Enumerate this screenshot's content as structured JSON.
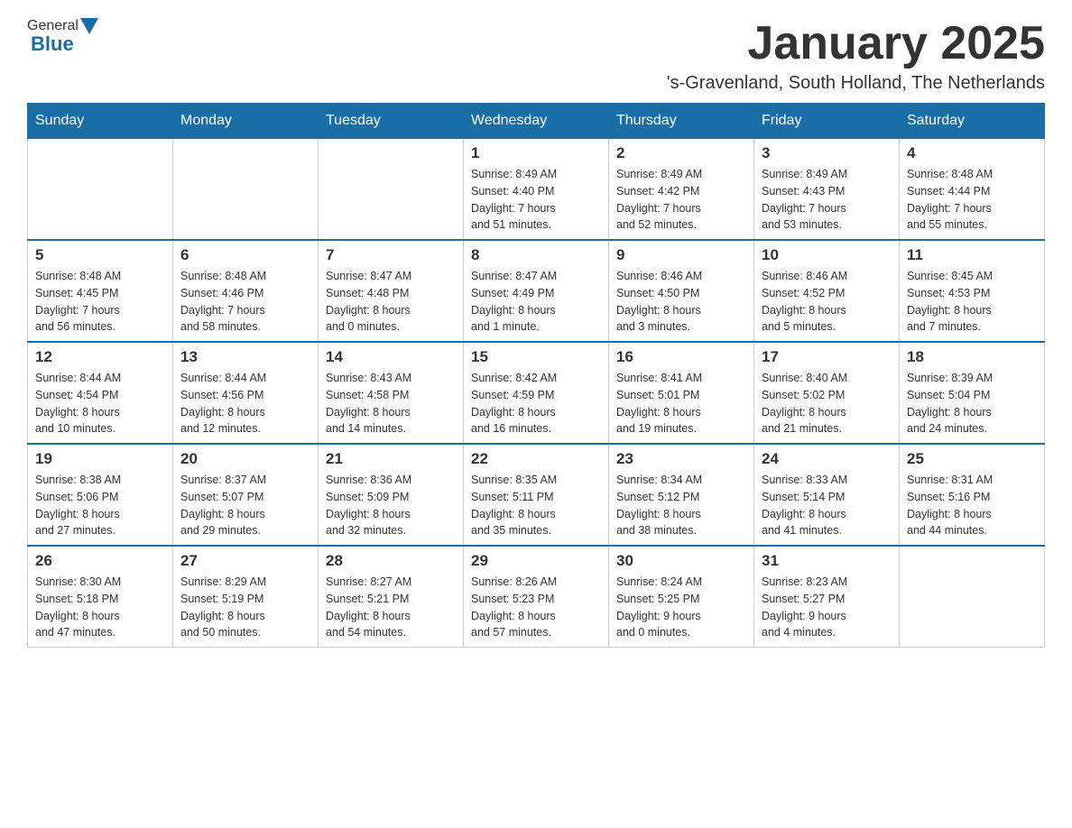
{
  "header": {
    "logo_general": "General",
    "logo_blue": "Blue",
    "month_title": "January 2025",
    "location": "'s-Gravenland, South Holland, The Netherlands"
  },
  "weekdays": [
    "Sunday",
    "Monday",
    "Tuesday",
    "Wednesday",
    "Thursday",
    "Friday",
    "Saturday"
  ],
  "weeks": [
    {
      "days": [
        {
          "num": "",
          "info": ""
        },
        {
          "num": "",
          "info": ""
        },
        {
          "num": "",
          "info": ""
        },
        {
          "num": "1",
          "info": "Sunrise: 8:49 AM\nSunset: 4:40 PM\nDaylight: 7 hours\nand 51 minutes."
        },
        {
          "num": "2",
          "info": "Sunrise: 8:49 AM\nSunset: 4:42 PM\nDaylight: 7 hours\nand 52 minutes."
        },
        {
          "num": "3",
          "info": "Sunrise: 8:49 AM\nSunset: 4:43 PM\nDaylight: 7 hours\nand 53 minutes."
        },
        {
          "num": "4",
          "info": "Sunrise: 8:48 AM\nSunset: 4:44 PM\nDaylight: 7 hours\nand 55 minutes."
        }
      ]
    },
    {
      "days": [
        {
          "num": "5",
          "info": "Sunrise: 8:48 AM\nSunset: 4:45 PM\nDaylight: 7 hours\nand 56 minutes."
        },
        {
          "num": "6",
          "info": "Sunrise: 8:48 AM\nSunset: 4:46 PM\nDaylight: 7 hours\nand 58 minutes."
        },
        {
          "num": "7",
          "info": "Sunrise: 8:47 AM\nSunset: 4:48 PM\nDaylight: 8 hours\nand 0 minutes."
        },
        {
          "num": "8",
          "info": "Sunrise: 8:47 AM\nSunset: 4:49 PM\nDaylight: 8 hours\nand 1 minute."
        },
        {
          "num": "9",
          "info": "Sunrise: 8:46 AM\nSunset: 4:50 PM\nDaylight: 8 hours\nand 3 minutes."
        },
        {
          "num": "10",
          "info": "Sunrise: 8:46 AM\nSunset: 4:52 PM\nDaylight: 8 hours\nand 5 minutes."
        },
        {
          "num": "11",
          "info": "Sunrise: 8:45 AM\nSunset: 4:53 PM\nDaylight: 8 hours\nand 7 minutes."
        }
      ]
    },
    {
      "days": [
        {
          "num": "12",
          "info": "Sunrise: 8:44 AM\nSunset: 4:54 PM\nDaylight: 8 hours\nand 10 minutes."
        },
        {
          "num": "13",
          "info": "Sunrise: 8:44 AM\nSunset: 4:56 PM\nDaylight: 8 hours\nand 12 minutes."
        },
        {
          "num": "14",
          "info": "Sunrise: 8:43 AM\nSunset: 4:58 PM\nDaylight: 8 hours\nand 14 minutes."
        },
        {
          "num": "15",
          "info": "Sunrise: 8:42 AM\nSunset: 4:59 PM\nDaylight: 8 hours\nand 16 minutes."
        },
        {
          "num": "16",
          "info": "Sunrise: 8:41 AM\nSunset: 5:01 PM\nDaylight: 8 hours\nand 19 minutes."
        },
        {
          "num": "17",
          "info": "Sunrise: 8:40 AM\nSunset: 5:02 PM\nDaylight: 8 hours\nand 21 minutes."
        },
        {
          "num": "18",
          "info": "Sunrise: 8:39 AM\nSunset: 5:04 PM\nDaylight: 8 hours\nand 24 minutes."
        }
      ]
    },
    {
      "days": [
        {
          "num": "19",
          "info": "Sunrise: 8:38 AM\nSunset: 5:06 PM\nDaylight: 8 hours\nand 27 minutes."
        },
        {
          "num": "20",
          "info": "Sunrise: 8:37 AM\nSunset: 5:07 PM\nDaylight: 8 hours\nand 29 minutes."
        },
        {
          "num": "21",
          "info": "Sunrise: 8:36 AM\nSunset: 5:09 PM\nDaylight: 8 hours\nand 32 minutes."
        },
        {
          "num": "22",
          "info": "Sunrise: 8:35 AM\nSunset: 5:11 PM\nDaylight: 8 hours\nand 35 minutes."
        },
        {
          "num": "23",
          "info": "Sunrise: 8:34 AM\nSunset: 5:12 PM\nDaylight: 8 hours\nand 38 minutes."
        },
        {
          "num": "24",
          "info": "Sunrise: 8:33 AM\nSunset: 5:14 PM\nDaylight: 8 hours\nand 41 minutes."
        },
        {
          "num": "25",
          "info": "Sunrise: 8:31 AM\nSunset: 5:16 PM\nDaylight: 8 hours\nand 44 minutes."
        }
      ]
    },
    {
      "days": [
        {
          "num": "26",
          "info": "Sunrise: 8:30 AM\nSunset: 5:18 PM\nDaylight: 8 hours\nand 47 minutes."
        },
        {
          "num": "27",
          "info": "Sunrise: 8:29 AM\nSunset: 5:19 PM\nDaylight: 8 hours\nand 50 minutes."
        },
        {
          "num": "28",
          "info": "Sunrise: 8:27 AM\nSunset: 5:21 PM\nDaylight: 8 hours\nand 54 minutes."
        },
        {
          "num": "29",
          "info": "Sunrise: 8:26 AM\nSunset: 5:23 PM\nDaylight: 8 hours\nand 57 minutes."
        },
        {
          "num": "30",
          "info": "Sunrise: 8:24 AM\nSunset: 5:25 PM\nDaylight: 9 hours\nand 0 minutes."
        },
        {
          "num": "31",
          "info": "Sunrise: 8:23 AM\nSunset: 5:27 PM\nDaylight: 9 hours\nand 4 minutes."
        },
        {
          "num": "",
          "info": ""
        }
      ]
    }
  ]
}
